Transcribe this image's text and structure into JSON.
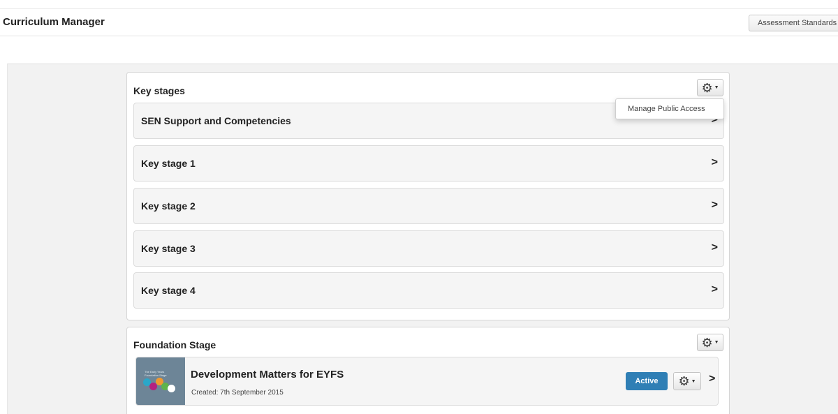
{
  "header": {
    "title": "Curriculum Manager",
    "assessment_standards_label": "Assessment Standards"
  },
  "key_stages_panel": {
    "title": "Key stages",
    "gear_icon": "gear-icon",
    "dropdown": {
      "items": [
        {
          "label": "Manage Public Access"
        }
      ]
    },
    "rows": [
      {
        "label": "SEN Support and Competencies"
      },
      {
        "label": "Key stage 1"
      },
      {
        "label": "Key stage 2"
      },
      {
        "label": "Key stage 3"
      },
      {
        "label": "Key stage 4"
      }
    ],
    "chevron_icon": "chevron-right-icon"
  },
  "foundation_panel": {
    "title": "Foundation Stage",
    "gear_icon": "gear-icon",
    "frameworks": [
      {
        "title": "Development Matters for EYFS",
        "created": "Created: 7th September 2015",
        "status": "Active",
        "thumbnail_text": "The Early Years\nFoundation Stage"
      }
    ]
  },
  "colors": {
    "active_badge": "#2f7fb5",
    "page_background": "#f2f2f2"
  }
}
